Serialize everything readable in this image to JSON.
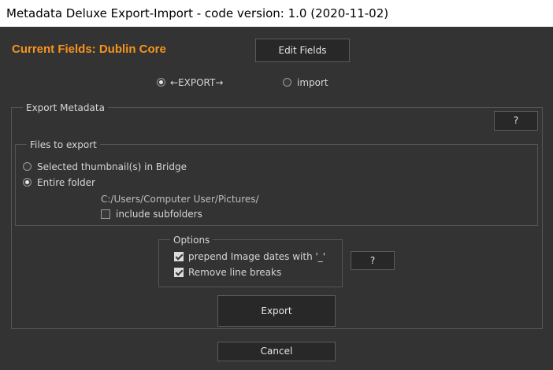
{
  "window": {
    "title": "Metadata Deluxe Export-Import - code version: 1.0 (2020-11-02)"
  },
  "header": {
    "current_fields": "Current Fields: Dublin Core",
    "edit_fields_label": "Edit Fields"
  },
  "mode": {
    "export_label": "←EXPORT→",
    "import_label": "import",
    "selected": "export"
  },
  "export_group": {
    "label": "Export Metadata",
    "help_label": "?",
    "files_group": {
      "label": "Files to export",
      "selected_thumbnails_label": "Selected thumbnail(s) in Bridge",
      "entire_folder_label": "Entire folder",
      "selected": "entire_folder",
      "folder_path": "C:/Users/Computer User/Pictures/",
      "include_subfolders_label": "include subfolders",
      "include_subfolders_checked": false
    },
    "options_group": {
      "label": "Options",
      "prepend_dates_label": "prepend Image dates with '_'",
      "prepend_dates_checked": true,
      "remove_line_breaks_label": "Remove line breaks",
      "remove_line_breaks_checked": true,
      "help_label": "?"
    },
    "export_button_label": "Export"
  },
  "footer": {
    "cancel_label": "Cancel"
  },
  "colors": {
    "accent": "#f7941d",
    "panel_bg": "#333333",
    "button_bg": "#282828"
  }
}
